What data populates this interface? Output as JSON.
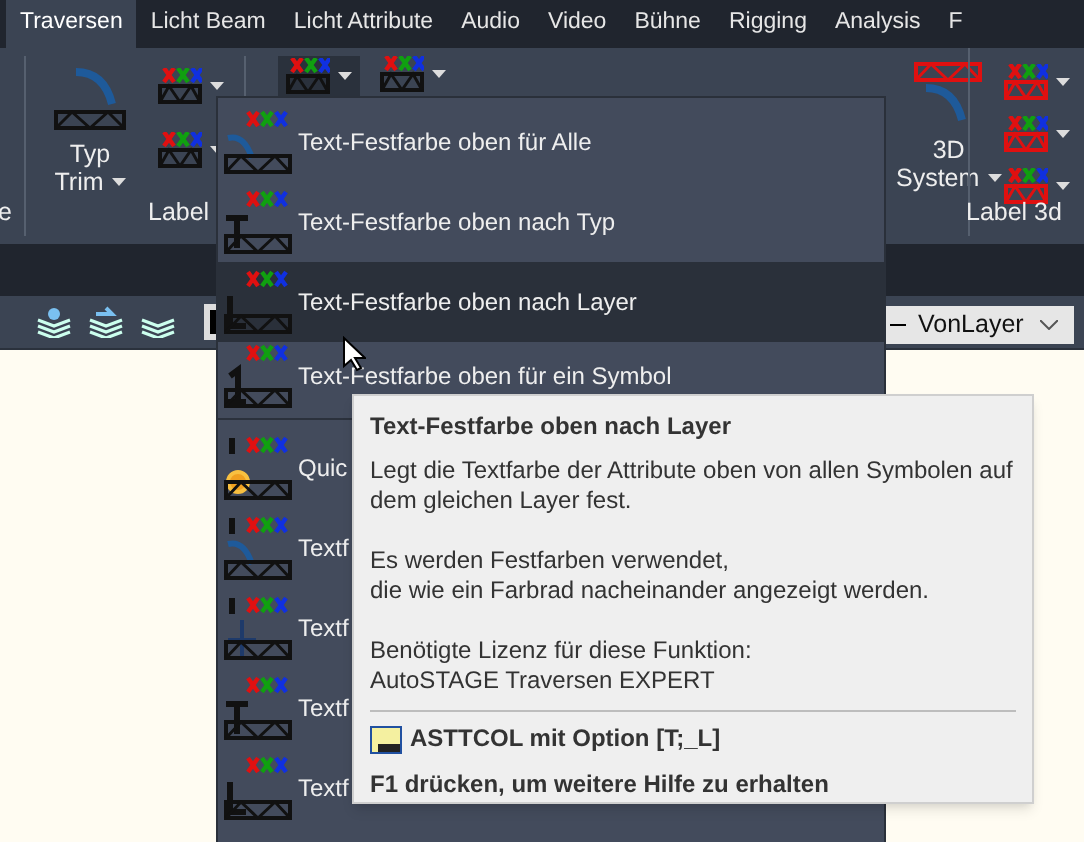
{
  "tabs": [
    {
      "label": "Traversen",
      "selected": true
    },
    {
      "label": "Licht Beam",
      "selected": false
    },
    {
      "label": "Licht Attribute",
      "selected": false
    },
    {
      "label": "Audio",
      "selected": false
    },
    {
      "label": "Video",
      "selected": false
    },
    {
      "label": "Bühne",
      "selected": false
    },
    {
      "label": "Rigging",
      "selected": false
    },
    {
      "label": "Analysis",
      "selected": false
    },
    {
      "label": "F",
      "selected": false
    }
  ],
  "ribbon": {
    "left_label": "e",
    "typ_trim": [
      "Typ",
      "Trim"
    ],
    "group_label": "Label",
    "system_button": [
      "3D",
      "System"
    ],
    "right_label": "Label 3d"
  },
  "toolbar": {
    "linetype": "VonLayer"
  },
  "menu": {
    "items": [
      {
        "kind": "all",
        "label": "Text-Festfarbe oben für Alle",
        "selected": false
      },
      {
        "kind": "type",
        "label": "Text-Festfarbe oben nach Typ",
        "selected": false
      },
      {
        "kind": "layer",
        "label": "Text-Festfarbe oben nach Layer",
        "selected": true
      },
      {
        "kind": "symbol",
        "label": "Text-Festfarbe oben für ein Symbol",
        "selected": false
      },
      {
        "kind": "separator"
      },
      {
        "kind": "quick",
        "label": "Quic",
        "selected": false
      },
      {
        "kind": "turn",
        "label": "Textf",
        "selected": false
      },
      {
        "kind": "cross",
        "label": "Textf",
        "selected": false
      },
      {
        "kind": "type",
        "label": "Textf",
        "selected": false
      },
      {
        "kind": "layer",
        "label": "Textf",
        "selected": false
      }
    ]
  },
  "tooltip": {
    "title": "Text-Festfarbe oben nach Layer",
    "paragraphs": [
      "Legt die Textfarbe der Attribute oben von allen Symbolen auf dem gleichen Layer fest.",
      "Es werden Festfarben verwendet,\ndie wie ein Farbrad nacheinander angezeigt werden.",
      "Benötigte Lizenz für diese Funktion:\nAutoSTAGE Traversen EXPERT"
    ],
    "command": "ASTTCOL mit Option [T;_L]",
    "help": "F1 drücken, um weitere Hilfe zu erhalten"
  }
}
